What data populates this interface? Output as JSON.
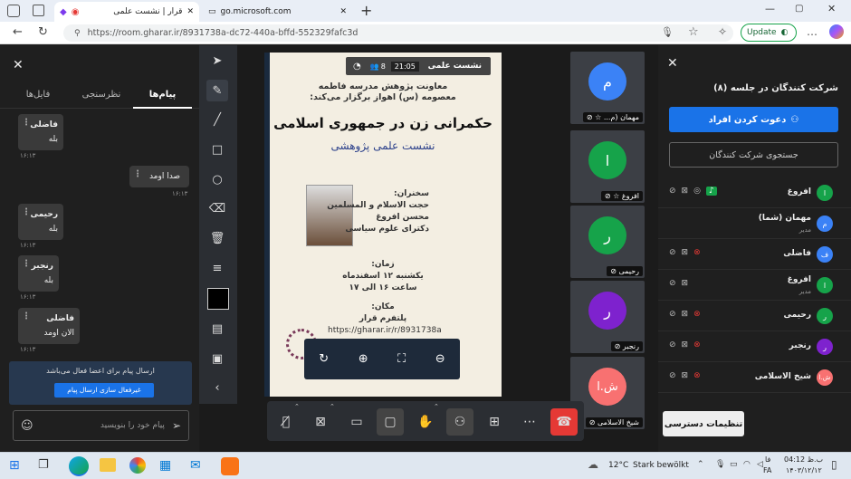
{
  "browser": {
    "tabs": [
      {
        "label": "قرار | نشست علمی",
        "active": true
      },
      {
        "label": "go.microsoft.com",
        "active": false
      }
    ],
    "url": "https://room.gharar.ir/8931738a-dc72-440a-bffd-552329fafc3d",
    "update_label": "Update"
  },
  "chat": {
    "tabs": [
      "پیام‌ها",
      "نظرسنجی",
      "فایل‌ها"
    ],
    "messages": [
      {
        "sender": "فاضلی",
        "text": "بله",
        "time": "۱۶:۱۳"
      },
      {
        "sender": "",
        "text": "صدا اومد",
        "time": "۱۶:۱۳"
      },
      {
        "sender": "رحیمی",
        "text": "بله",
        "time": "۱۶:۱۳"
      },
      {
        "sender": "رنجبر",
        "text": "بله",
        "time": "۱۶:۱۳"
      },
      {
        "sender": "فاضلی",
        "text": "الان اومد",
        "time": "۱۶:۱۳"
      }
    ],
    "notice": "ارسال پیام برای اعضا فعال می‌باشد",
    "disable_button": "غیرفعال سازی ارسال پیام",
    "input_placeholder": "پیام خود را بنویسید"
  },
  "session": {
    "title": "نشست علمی",
    "timer": "21:05",
    "count_badge": "8"
  },
  "slide": {
    "org_line1": "معاونت پژوهش مدرسه فاطمه",
    "org_line2": "معصومه (س) اهواز برگزار می‌کند:",
    "headline": "حکمرانی زن در جمهوری اسلامی",
    "subtitle": "نشست علمی پژوهشی",
    "speaker_label": "سخنران:",
    "speaker_line1": "حجت الاسلام و المسلمین",
    "speaker_line2": "محسن افروغ",
    "speaker_line3": "دکترای علوم سیاسی",
    "time_label": "زمان:",
    "time_line1": "یکشنبه ۱۲ اسفندماه",
    "time_line2": "ساعت ۱۶ الی ۱۷",
    "place_label": "مکان:",
    "place_line1": "پلتفرم قرار",
    "place_line2": "https://gharar.ir/r/8931738a"
  },
  "tiles": [
    {
      "initial": "م",
      "name": "مهمان (م...",
      "color": "#3b82f6"
    },
    {
      "initial": "ا",
      "name": "افروغ",
      "color": "#16a34a"
    },
    {
      "initial": "ر",
      "name": "رحیمی",
      "color": "#16a34a"
    },
    {
      "initial": "ر",
      "name": "رنجبر",
      "color": "#7e22ce"
    },
    {
      "initial": "ش.ا",
      "name": "شیخ الاسلامی",
      "color": "#f87171"
    }
  ],
  "participants": {
    "title": "شرکت کنندگان در جلسه (۸)",
    "invite_button": "دعوت کردن افراد",
    "search_placeholder": "جستجوی شرکت کنندگان",
    "list": [
      {
        "initial": "ا",
        "name": "افروغ",
        "role": "",
        "color": "#16a34a"
      },
      {
        "initial": "م",
        "name": "مهمان (شما)",
        "role": "مدیر",
        "color": "#3b82f6"
      },
      {
        "initial": "ف",
        "name": "فاضلی",
        "role": "",
        "color": "#3b82f6"
      },
      {
        "initial": "ا",
        "name": "افروغ",
        "role": "مدیر",
        "color": "#16a34a"
      },
      {
        "initial": "ر",
        "name": "رحیمی",
        "role": "",
        "color": "#16a34a"
      },
      {
        "initial": "ر",
        "name": "رنجبر",
        "role": "",
        "color": "#7e22ce"
      },
      {
        "initial": "ش.ا",
        "name": "شیخ الاسلامی",
        "role": "",
        "color": "#f87171"
      }
    ],
    "access_button": "تنظیمات دسترسی"
  },
  "taskbar": {
    "weather_temp": "12°C",
    "weather_text": "Stark bewölkt",
    "lang": "FA",
    "lang2": "فا",
    "clock_time": "ب.ظ 04:12",
    "clock_date": "۱۴۰۳/۱۲/۱۲"
  },
  "colors": {
    "accent": "#1a73e8",
    "danger": "#e53935",
    "panel": "#1f1f1f"
  }
}
